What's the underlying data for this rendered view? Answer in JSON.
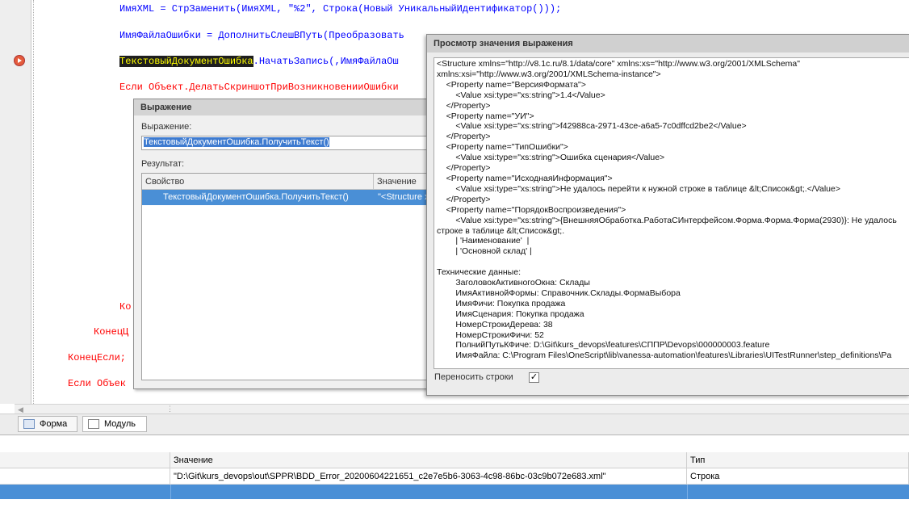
{
  "editor": {
    "line1": "ИмяXML = СтрЗаменить(ИмяXML, \"%2\", Строка(Новый УникальныйИдентификатор()));",
    "line2": "ИмяФайлаОшибки = ДополнитьСлешВПуть(Преобразовать",
    "line3_hl": "ТекстовыйДокументОшибка",
    "line3_rest": ".НачатьЗапись(,ИмяФайлаОш",
    "line4": "Если Объект.ДелатьСкриншотПриВозникновенииОшибки",
    "line5": "Ко",
    "line6": "КонецЦ",
    "line7": "КонецЕсли;",
    "line8": "Если Объек"
  },
  "tabs": [
    {
      "label": "Форма",
      "icon": "form-icon"
    },
    {
      "label": "Модуль",
      "icon": "module-icon"
    }
  ],
  "variables": {
    "headers": [
      "Значение",
      "Тип"
    ],
    "row": {
      "value": "\"D:\\Git\\kurs_devops\\out\\SPPR\\BDD_Error_20200604221651_c2e7e5b6-3063-4c98-86bc-03c9b072e683.xml\"",
      "type": "Строка"
    }
  },
  "expression_dialog": {
    "title": "Выражение",
    "expr_label": "Выражение:",
    "expr_value": "ТекстовыйДокументОшибка.ПолучитьТекст()",
    "result_label": "Результат:",
    "col_property": "Свойство",
    "col_value": "Значение",
    "row_property": "ТекстовыйДокументОшибка.ПолучитьТекст()",
    "row_value": "\"<Structure x"
  },
  "value_dialog": {
    "title": "Просмотр значения выражения",
    "text": "<Structure xmlns=\"http://v8.1c.ru/8.1/data/core\" xmlns:xs=\"http://www.w3.org/2001/XMLSchema\"\nxmlns:xsi=\"http://www.w3.org/2001/XMLSchema-instance\">\n    <Property name=\"ВерсияФормата\">\n        <Value xsi:type=\"xs:string\">1.4</Value>\n    </Property>\n    <Property name=\"УИ\">\n        <Value xsi:type=\"xs:string\">f42988ca-2971-43ce-a6a5-7c0dffcd2be2</Value>\n    </Property>\n    <Property name=\"ТипОшибки\">\n        <Value xsi:type=\"xs:string\">Ошибка сценария</Value>\n    </Property>\n    <Property name=\"ИсходнаяИнформация\">\n        <Value xsi:type=\"xs:string\">Не удалось перейти к нужной строке в таблице &lt;Список&gt;.</Value>\n    </Property>\n    <Property name=\"ПорядокВоспроизведения\">\n        <Value xsi:type=\"xs:string\">{ВнешняяОбработка.РаботаСИнтерфейсом.Форма.Форма.Форма(2930)}: Не удалось\nстроке в таблице &lt;Список&gt;.\n        | 'Наименование'  |\n        | 'Основной склад' |\n\nТехнические данные:\n        ЗаголовокАктивногоОкна: Склады\n        ИмяАктивнойФормы: Справочник.Склады.ФормаВыбора\n        ИмяФичи: Покупка продажа\n        ИмяСценария: Покупка продажа\n        НомерСтрокиДерева: 38\n        НомерСтрокиФичи: 52\n        ПолнийПутьКФиче: D:\\Git\\kurs_devops\\features\\СППР\\Devops\\000000003.feature\n        ИмяФайла: C:\\Program Files\\OneScript\\lib\\vanessa-automation\\features\\Libraries\\UITestRunner\\step_definitions\\Pa",
    "wrap_label": "Переносить строки",
    "wrap_checked": "✓"
  }
}
